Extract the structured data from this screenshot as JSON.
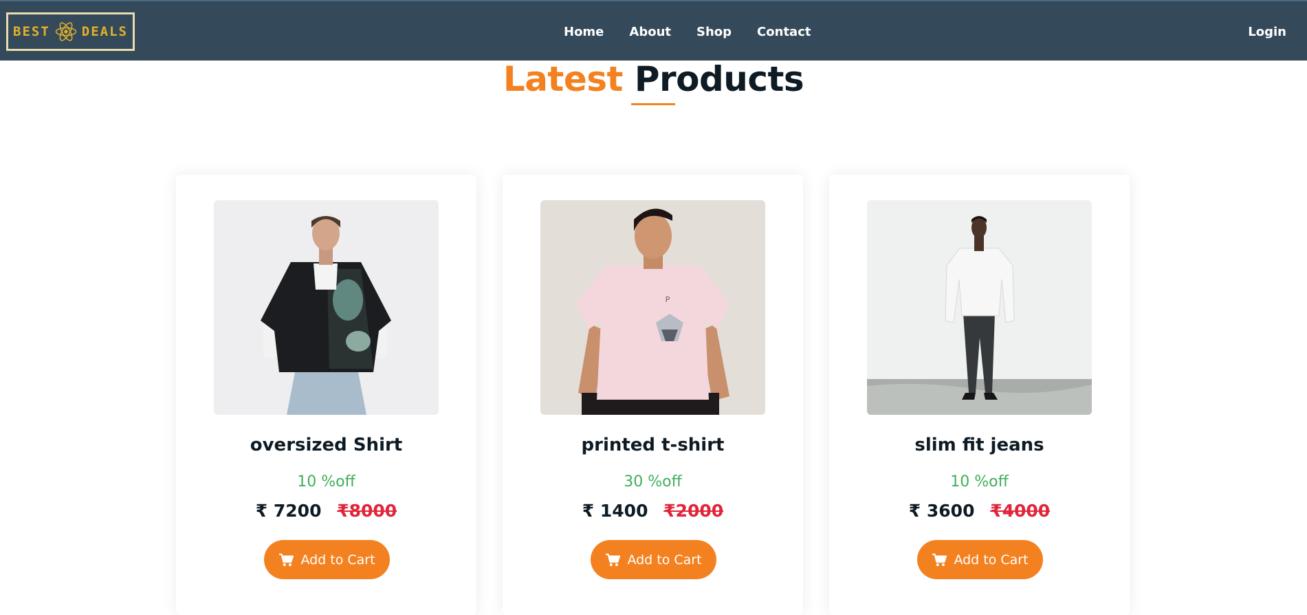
{
  "brand": {
    "logo_text_left": "BEST",
    "logo_text_right": "DEALS"
  },
  "nav": {
    "links": [
      "Home",
      "About",
      "Shop",
      "Contact"
    ],
    "login": "Login"
  },
  "section": {
    "title_accent": "Latest",
    "title_main": "Products"
  },
  "products": [
    {
      "name": "oversized Shirt",
      "discount": "10 %off",
      "price": "₹ 7200",
      "old_price": "₹8000",
      "button": "Add to Cart"
    },
    {
      "name": "printed t-shirt",
      "discount": "30 %off",
      "price": "₹ 1400",
      "old_price": "₹2000",
      "button": "Add to Cart"
    },
    {
      "name": "slim fit jeans",
      "discount": "10 %off",
      "price": "₹ 3600",
      "old_price": "₹4000",
      "button": "Add to Cart"
    }
  ],
  "colors": {
    "nav_bg": "#344a5a",
    "accent": "#f48120",
    "discount": "#3fae5a",
    "old_price": "#e0253a",
    "logo": "#e3b12a"
  },
  "icons": {
    "cart": "shopping-cart-icon",
    "logo": "atom-icon"
  }
}
